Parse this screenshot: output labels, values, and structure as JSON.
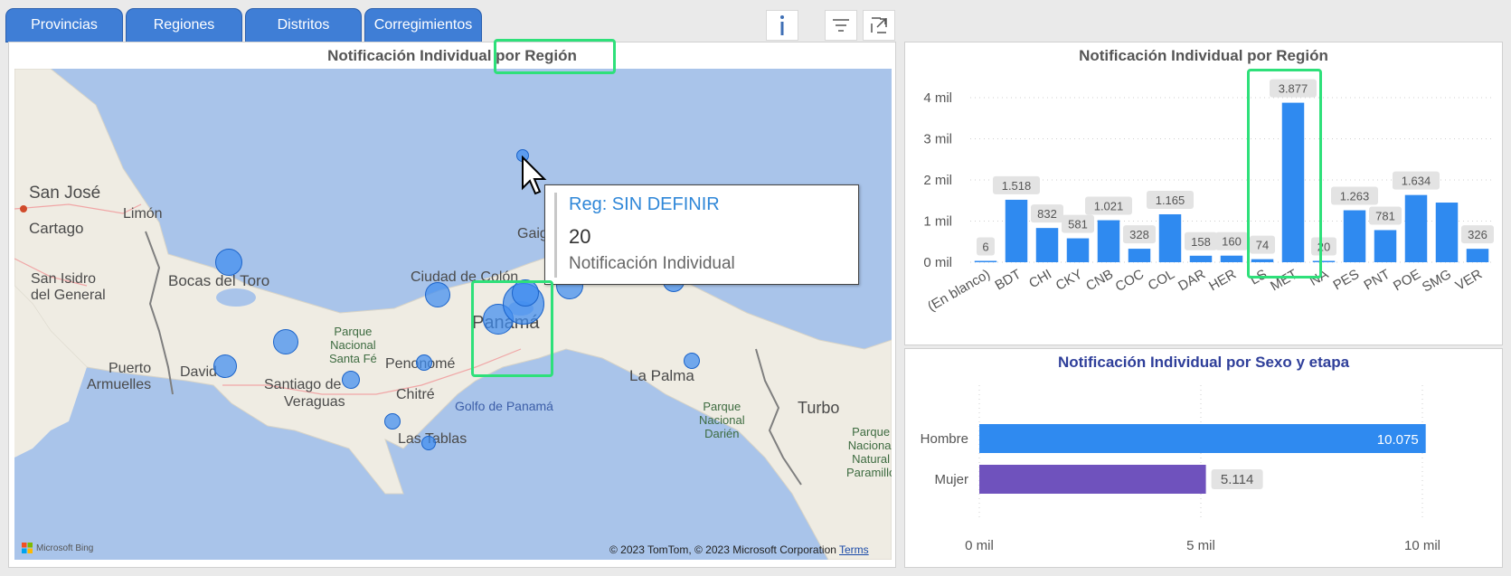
{
  "tabs": [
    {
      "label": "Provincias"
    },
    {
      "label": "Regiones"
    },
    {
      "label": "Distritos"
    },
    {
      "label": "Corregimientos"
    }
  ],
  "toolbar": {
    "info_icon": "info-icon",
    "filter_icon": "filter-icon",
    "focus_icon": "focus-mode-icon"
  },
  "map_panel": {
    "title": "Notificación Individual por Región",
    "labels": {
      "san_jose": "San José",
      "cartago": "Cartago",
      "limon": "Limón",
      "bocas": "Bocas del Toro",
      "san_isidro": "San Isidro",
      "del_general": "del General",
      "puerto": "Puerto",
      "armuelles": "Armuelles",
      "david": "David",
      "santiago": "Santiago de",
      "veraguas": "Veraguas",
      "parque_santa_fe_1": "Parque",
      "parque_santa_fe_2": "Nacional",
      "parque_santa_fe_3": "Santa Fé",
      "penonome": "Penonomé",
      "chitre": "Chitré",
      "las_tablas": "Las Tablas",
      "golfo": "Golfo de Panamá",
      "ciudad_colon": "Ciudad de Colón",
      "panama": "Panamá",
      "gaigirgordub": "Gaigirgordub",
      "la_palma": "La Palma",
      "darien_1": "Parque",
      "darien_2": "Nacional",
      "darien_3": "Darién",
      "turbo": "Turbo",
      "paramillo_1": "Parque",
      "paramillo_2": "Nacional",
      "paramillo_3": "Natural",
      "paramillo_4": "Paramillo"
    },
    "attribution": "© 2023 TomTom, © 2023 Microsoft Corporation",
    "terms": "Terms",
    "bing": "Microsoft Bing",
    "tooltip": {
      "title": "Reg: SIN DEFINIR",
      "value": "20",
      "measure": "Notificación Individual"
    }
  },
  "bar_panel": {
    "title": "Notificación Individual por Región"
  },
  "hbar_panel": {
    "title": "Notificación Individual por Sexo y etapa"
  },
  "colors": {
    "accent": "#2f8af0",
    "purple": "#6f52bd",
    "highlight": "#2ee07a",
    "tab": "#3f7ed6"
  },
  "chart_data": [
    {
      "type": "bar",
      "title": "Notificación Individual por Región",
      "categories": [
        "(En blanco)",
        "BDT",
        "CHI",
        "CKY",
        "CNB",
        "COC",
        "COL",
        "DAR",
        "HER",
        "LS",
        "MET",
        "NA",
        "PES",
        "PNT",
        "POE",
        "SMG",
        "VER"
      ],
      "values": [
        6,
        1518,
        832,
        581,
        1021,
        328,
        1165,
        158,
        160,
        74,
        3877,
        20,
        1263,
        781,
        1634,
        1450,
        326
      ],
      "data_labels": [
        "6",
        "1.518",
        "832",
        "581",
        "1.021",
        "328",
        "1.165",
        "158",
        "160",
        "74",
        "3.877",
        "20",
        "1.263",
        "781",
        "1.634",
        "",
        "326"
      ],
      "y_ticks": [
        "0 mil",
        "1 mil",
        "2 mil",
        "3 mil",
        "4 mil"
      ],
      "ylim": [
        0,
        4000
      ],
      "grid": true
    },
    {
      "type": "bar",
      "orientation": "horizontal",
      "title": "Notificación Individual por Sexo y etapa",
      "categories": [
        "Hombre",
        "Mujer"
      ],
      "values": [
        10075,
        5114
      ],
      "data_labels": [
        "10.075",
        "5.114"
      ],
      "x_ticks": [
        "0 mil",
        "5 mil",
        "10 mil"
      ],
      "xlim": [
        0,
        10000
      ],
      "grid": true
    }
  ]
}
